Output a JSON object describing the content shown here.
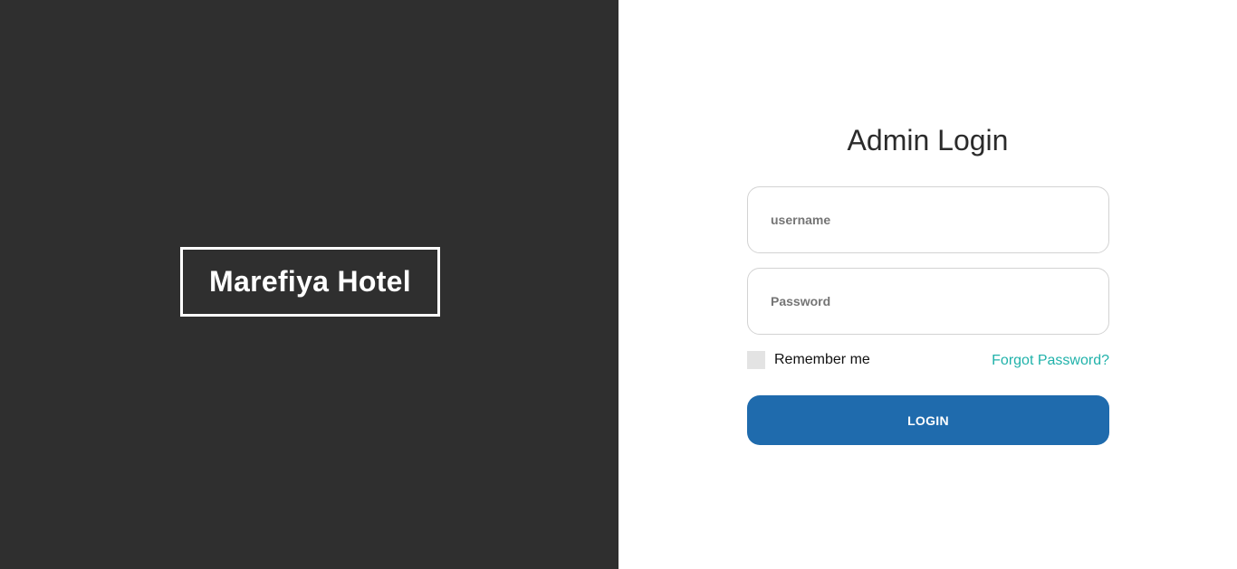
{
  "brand": {
    "name": "Marefiya Hotel"
  },
  "login": {
    "title": "Admin Login",
    "username_placeholder": "username",
    "username_value": "",
    "password_placeholder": "Password",
    "password_value": "",
    "remember_label": "Remember me",
    "remember_checked": false,
    "forgot_label": "Forgot Password?",
    "submit_label": "LOGIN"
  },
  "colors": {
    "left_panel_bg": "#2f2f2f",
    "accent_link": "#20b2aa",
    "button_bg": "#1f6bad"
  }
}
